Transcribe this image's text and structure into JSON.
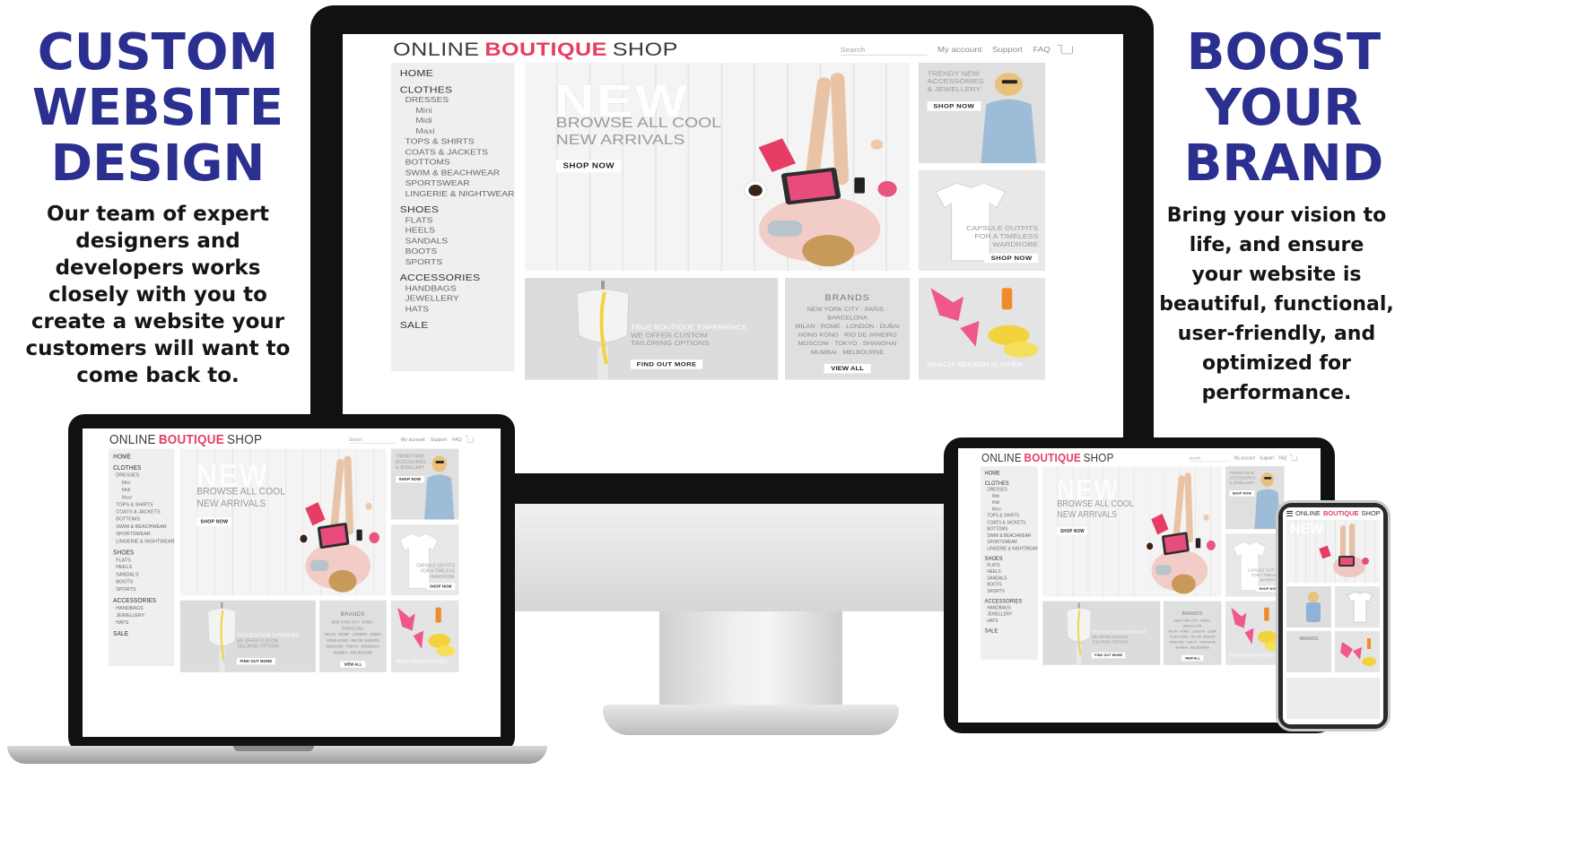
{
  "left_panel": {
    "headline_lines": [
      "CUSTOM",
      "WEBSITE",
      "DESIGN"
    ],
    "body_lines": [
      "Our team of expert",
      "designers and",
      "developers works",
      "closely with you to",
      "create a website your",
      "customers will want to",
      "come back to."
    ]
  },
  "right_panel": {
    "headline_lines": [
      "BOOST",
      "YOUR",
      "BRAND"
    ],
    "body_lines": [
      "Bring your vision to",
      "life, and ensure",
      "your website is",
      "beautiful, functional,",
      "user-friendly, and",
      "optimized for",
      "performance."
    ]
  },
  "site": {
    "brand": {
      "part1": "ONLINE",
      "part2": "BOUTIQUE",
      "part3": "SHOP"
    },
    "utility_nav": {
      "search_placeholder": "Search",
      "my_account": "My account",
      "support": "Support",
      "faq": "FAQ"
    },
    "sidebar": [
      {
        "type": "cat",
        "label": "HOME"
      },
      {
        "type": "cat",
        "label": "CLOTHES"
      },
      {
        "type": "sub",
        "label": "DRESSES"
      },
      {
        "type": "subsub",
        "label": "Mini"
      },
      {
        "type": "subsub",
        "label": "Midi"
      },
      {
        "type": "subsub",
        "label": "Maxi"
      },
      {
        "type": "sub",
        "label": "TOPS & SHIRTS"
      },
      {
        "type": "sub",
        "label": "COATS & JACKETS"
      },
      {
        "type": "sub",
        "label": "BOTTOMS"
      },
      {
        "type": "sub",
        "label": "SWIM & BEACHWEAR"
      },
      {
        "type": "sub",
        "label": "SPORTSWEAR"
      },
      {
        "type": "sub",
        "label": "LINGERIE & NIGHTWEAR"
      },
      {
        "type": "cat",
        "label": "SHOES"
      },
      {
        "type": "sub",
        "label": "FLATS"
      },
      {
        "type": "sub",
        "label": "HEELS"
      },
      {
        "type": "sub",
        "label": "SANDALS"
      },
      {
        "type": "sub",
        "label": "BOOTS"
      },
      {
        "type": "sub",
        "label": "SPORTS"
      },
      {
        "type": "cat",
        "label": "ACCESSORIES"
      },
      {
        "type": "sub",
        "label": "HANDBAGS"
      },
      {
        "type": "sub",
        "label": "JEWELLERY"
      },
      {
        "type": "sub",
        "label": "HATS"
      },
      {
        "type": "cat",
        "label": "SALE"
      }
    ],
    "hero": {
      "title": "NEW",
      "subtitle_line1": "BROWSE ALL COOL",
      "subtitle_line2": "NEW ARRIVALS",
      "button": "SHOP NOW"
    },
    "promo_top_right": {
      "line1": "TRENDY NEW",
      "line2": "ACCESSORIES",
      "line3": "& JEWELLERY",
      "button": "SHOP NOW"
    },
    "promo_mid_right": {
      "line1": "CAPSULE OUTFITS",
      "line2": "FOR A TIMELESS",
      "line3": "WARDROBE",
      "button": "SHOP NOW"
    },
    "promo_tailoring": {
      "line1": "TRUE BOUTIQUE EXPERIENCE",
      "line2": "WE OFFER CUSTOM",
      "line3": "TAILORING OPTIONS",
      "button": "FIND OUT MORE"
    },
    "brands": {
      "title": "BRANDS",
      "line1": "NEW YORK CITY · PARIS · BARCELONA",
      "line2": "MILAN · ROME · LONDON · DUBAI",
      "line3": "HONG KONG · RIO DE JANEIRO",
      "line4": "MOSCOW · TOKYO · SHANGHAI",
      "line5": "MUMBAI · MELBOURNE",
      "button": "VIEW ALL"
    },
    "promo_beach": {
      "line1": "BEACH SEASON IS OPEN"
    }
  },
  "phone": {
    "menu_icon": "hamburger-icon"
  },
  "colors": {
    "headline": "#2b2f8f",
    "accent": "#e63d64",
    "bezel": "#111111"
  }
}
